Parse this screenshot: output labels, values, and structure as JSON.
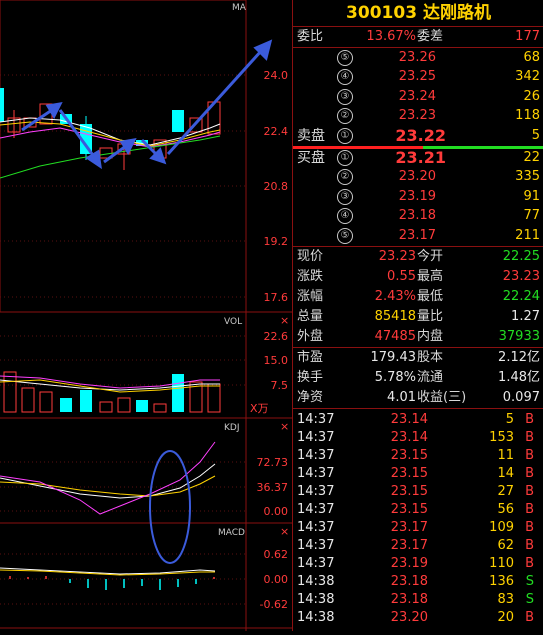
{
  "chart": {
    "main_label": "MA",
    "price_ticks": [
      "24.0",
      "22.4",
      "20.8",
      "19.2",
      "17.6"
    ],
    "vol_label": "VOL",
    "vol_ticks": [
      "22.6",
      "15.0",
      "7.5"
    ],
    "vol_unit": "X万",
    "kdj_label": "KDJ",
    "kdj_ticks": [
      "72.73",
      "36.37",
      "0.00"
    ],
    "macd_label": "MACD",
    "macd_ticks": [
      "0.62",
      "0.00",
      "-0.62"
    ]
  },
  "quote": {
    "code": "300103",
    "name": "达刚路机",
    "weibi_label": "委比",
    "weibi_value": "13.67%",
    "weicha_label": "委差",
    "weicha_value": "177",
    "sell_label": "卖盘",
    "buy_label": "买盘",
    "sell": [
      {
        "n": "⑤",
        "price": "23.26",
        "vol": "68"
      },
      {
        "n": "④",
        "price": "23.25",
        "vol": "342"
      },
      {
        "n": "③",
        "price": "23.24",
        "vol": "26"
      },
      {
        "n": "②",
        "price": "23.23",
        "vol": "118"
      },
      {
        "n": "①",
        "price": "23.22",
        "vol": "5"
      }
    ],
    "buy": [
      {
        "n": "①",
        "price": "23.21",
        "vol": "22"
      },
      {
        "n": "②",
        "price": "23.20",
        "vol": "335"
      },
      {
        "n": "③",
        "price": "23.19",
        "vol": "91"
      },
      {
        "n": "④",
        "price": "23.18",
        "vol": "77"
      },
      {
        "n": "⑤",
        "price": "23.17",
        "vol": "211"
      }
    ],
    "stats": [
      {
        "l1": "现价",
        "v1": "23.23",
        "c1": "red",
        "l2": "今开",
        "v2": "22.25",
        "c2": "green"
      },
      {
        "l1": "涨跌",
        "v1": "0.55",
        "c1": "red",
        "l2": "最高",
        "v2": "23.23",
        "c2": "red"
      },
      {
        "l1": "涨幅",
        "v1": "2.43%",
        "c1": "red",
        "l2": "最低",
        "v2": "22.24",
        "c2": "green"
      },
      {
        "l1": "总量",
        "v1": "85418",
        "c1": "yellow",
        "l2": "量比",
        "v2": "1.27",
        "c2": "white"
      },
      {
        "l1": "外盘",
        "v1": "47485",
        "c1": "red",
        "l2": "内盘",
        "v2": "37933",
        "c2": "green"
      }
    ],
    "stats2": [
      {
        "l1": "市盈",
        "v1": "179.43",
        "l2": "股本",
        "v2": "2.12亿"
      },
      {
        "l1": "换手",
        "v1": "5.78%",
        "l2": "流通",
        "v2": "1.48亿"
      },
      {
        "l1": "净资",
        "v1": "4.01",
        "l2": "收益(三)",
        "v2": "0.097"
      }
    ],
    "ticks": [
      {
        "time": "14:37",
        "price": "23.14",
        "vol": "5",
        "side": "B"
      },
      {
        "time": "14:37",
        "price": "23.14",
        "vol": "153",
        "side": "B"
      },
      {
        "time": "14:37",
        "price": "23.15",
        "vol": "11",
        "side": "B"
      },
      {
        "time": "14:37",
        "price": "23.15",
        "vol": "14",
        "side": "B"
      },
      {
        "time": "14:37",
        "price": "23.15",
        "vol": "27",
        "side": "B"
      },
      {
        "time": "14:37",
        "price": "23.15",
        "vol": "56",
        "side": "B"
      },
      {
        "time": "14:37",
        "price": "23.17",
        "vol": "109",
        "side": "B"
      },
      {
        "time": "14:37",
        "price": "23.17",
        "vol": "62",
        "side": "B"
      },
      {
        "time": "14:37",
        "price": "23.19",
        "vol": "110",
        "side": "B"
      },
      {
        "time": "14:38",
        "price": "23.18",
        "vol": "136",
        "side": "S"
      },
      {
        "time": "14:38",
        "price": "23.18",
        "vol": "83",
        "side": "S"
      },
      {
        "time": "14:38",
        "price": "23.20",
        "vol": "20",
        "side": "B"
      }
    ],
    "colors": {
      "up": "#ff3b3b",
      "down": "#22dd22",
      "accent": "#ffd200",
      "border": "#8a1010"
    }
  }
}
